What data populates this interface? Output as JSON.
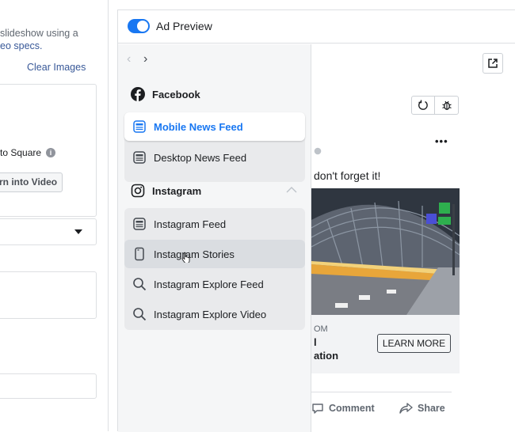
{
  "left_panel": {
    "description_line1": "slideshow using a",
    "description_line2": "eo specs.",
    "clear_images": "Clear Images",
    "crop_label": "to Square",
    "info_icon": "i",
    "turn_into_video": "rn into Video"
  },
  "preview": {
    "title": "Ad Preview",
    "toggle_on": true,
    "external_icon": "external-link-icon"
  },
  "menu": {
    "facebook_heading": "Facebook",
    "facebook_items": [
      {
        "label": "Mobile News Feed",
        "icon": "mobile-icon",
        "selected": true
      },
      {
        "label": "Desktop News Feed",
        "icon": "desktop-icon",
        "selected": false
      }
    ],
    "instagram_heading": "Instagram",
    "instagram_items": [
      {
        "label": "Instagram Feed",
        "icon": "feed-icon"
      },
      {
        "label": "Instagram Stories",
        "icon": "stories-icon",
        "hovered": true
      },
      {
        "label": "Instagram Explore Feed",
        "icon": "search-icon"
      },
      {
        "label": "Instagram Explore Video",
        "icon": "search-icon"
      }
    ]
  },
  "ad": {
    "refresh_icon": "refresh-icon",
    "bug_icon": "bug-icon",
    "more": "•••",
    "message": "don't forget it!",
    "domain_fragment": "OM",
    "headline_line1": "l",
    "headline_line2": "ation",
    "cta": "LEARN MORE",
    "comment": "Comment",
    "share": "Share"
  },
  "colors": {
    "accent": "#1877f2",
    "link": "#385898",
    "menu_bg": "#f5f6f7"
  }
}
